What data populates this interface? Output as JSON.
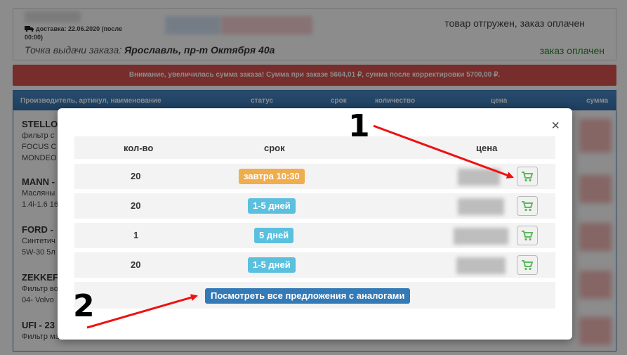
{
  "order": {
    "delivery_label": "доставка: 22.06.2020 (после 00:00)",
    "status": "товар отгружен, заказ оплачен",
    "pickup_label": "Точка выдачи заказа:",
    "pickup_value": "Ярославль, пр-т Октября 40а",
    "paid": "заказ оплачен"
  },
  "alert": {
    "text": "Внимание, увеличилась сумма заказа! Сумма при заказе 5664,01 ₽, сумма после корректировки 5700,00 ₽."
  },
  "table": {
    "headers": [
      "Производитель, артикул, наименование",
      "статус",
      "срок",
      "количество",
      "цена",
      "сумма"
    ],
    "rows": [
      {
        "brand": "STELLO",
        "lines": [
          "фильтр с",
          "FOCUS C",
          "MONDEO"
        ]
      },
      {
        "brand": "MANN -",
        "lines": [
          "Масляны",
          "1.4i-1.6 16"
        ]
      },
      {
        "brand": "FORD -",
        "lines": [
          "Синтетич",
          "5W-30 5л"
        ]
      },
      {
        "brand": "ZEKKEF",
        "lines": [
          "Фильтр во",
          "04- Volvo"
        ]
      },
      {
        "brand": "UFI - 23",
        "lines": [
          "Фильтр ма"
        ]
      }
    ]
  },
  "modal": {
    "close_symbol": "×",
    "headers": {
      "qty": "кол-во",
      "term": "срок",
      "price": "цена"
    },
    "offers": [
      {
        "qty": "20",
        "term": "завтра 10:30",
        "term_style": "orange"
      },
      {
        "qty": "20",
        "term": "1-5 дней",
        "term_style": "blue"
      },
      {
        "qty": "1",
        "term": "5 дней",
        "term_style": "blue"
      },
      {
        "qty": "20",
        "term": "1-5 дней",
        "term_style": "blue"
      }
    ],
    "all_offers_button": "Посмотреть все предложения с аналогами"
  },
  "annotations": {
    "label1": "1",
    "label2": "2",
    "arrow_color": "#ee1111"
  },
  "colors": {
    "alert": "#d9534f",
    "table_header": "#3d7ab8",
    "badge_orange": "#f0ad4e",
    "badge_blue": "#5bc0de",
    "primary_button": "#337ab7",
    "paid_text": "#2a8a2a"
  },
  "icons": {
    "delivery": "truck-icon",
    "add_to_cart": "cart-icon",
    "close": "close-icon"
  }
}
